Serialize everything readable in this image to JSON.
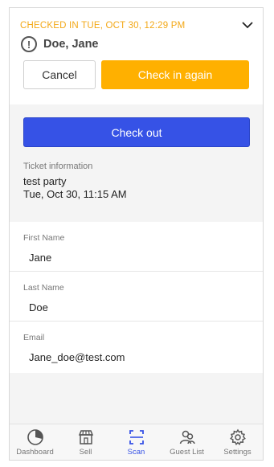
{
  "header": {
    "status_text": "CHECKED IN TUE, OCT 30, 12:29 PM",
    "guest_name": "Doe, Jane",
    "cancel_label": "Cancel",
    "checkin_again_label": "Check in again"
  },
  "checkout": {
    "label": "Check out"
  },
  "ticket": {
    "heading": "Ticket information",
    "event": "test party",
    "date": "Tue, Oct 30, 11:15 AM"
  },
  "fields": [
    {
      "label": "First Name",
      "value": "Jane"
    },
    {
      "label": "Last Name",
      "value": "Doe"
    },
    {
      "label": "Email",
      "value": "Jane_doe@test.com"
    }
  ],
  "tabs": [
    {
      "label": "Dashboard",
      "icon": "dashboard-icon"
    },
    {
      "label": "Sell",
      "icon": "store-icon"
    },
    {
      "label": "Scan",
      "icon": "scan-icon"
    },
    {
      "label": "Guest List",
      "icon": "guest-list-icon"
    },
    {
      "label": "Settings",
      "icon": "gear-icon"
    }
  ],
  "colors": {
    "status_orange": "#f3a817",
    "checkin_button": "#ffb000",
    "checkout_button": "#3652e6",
    "active_tab": "#3652e6"
  }
}
